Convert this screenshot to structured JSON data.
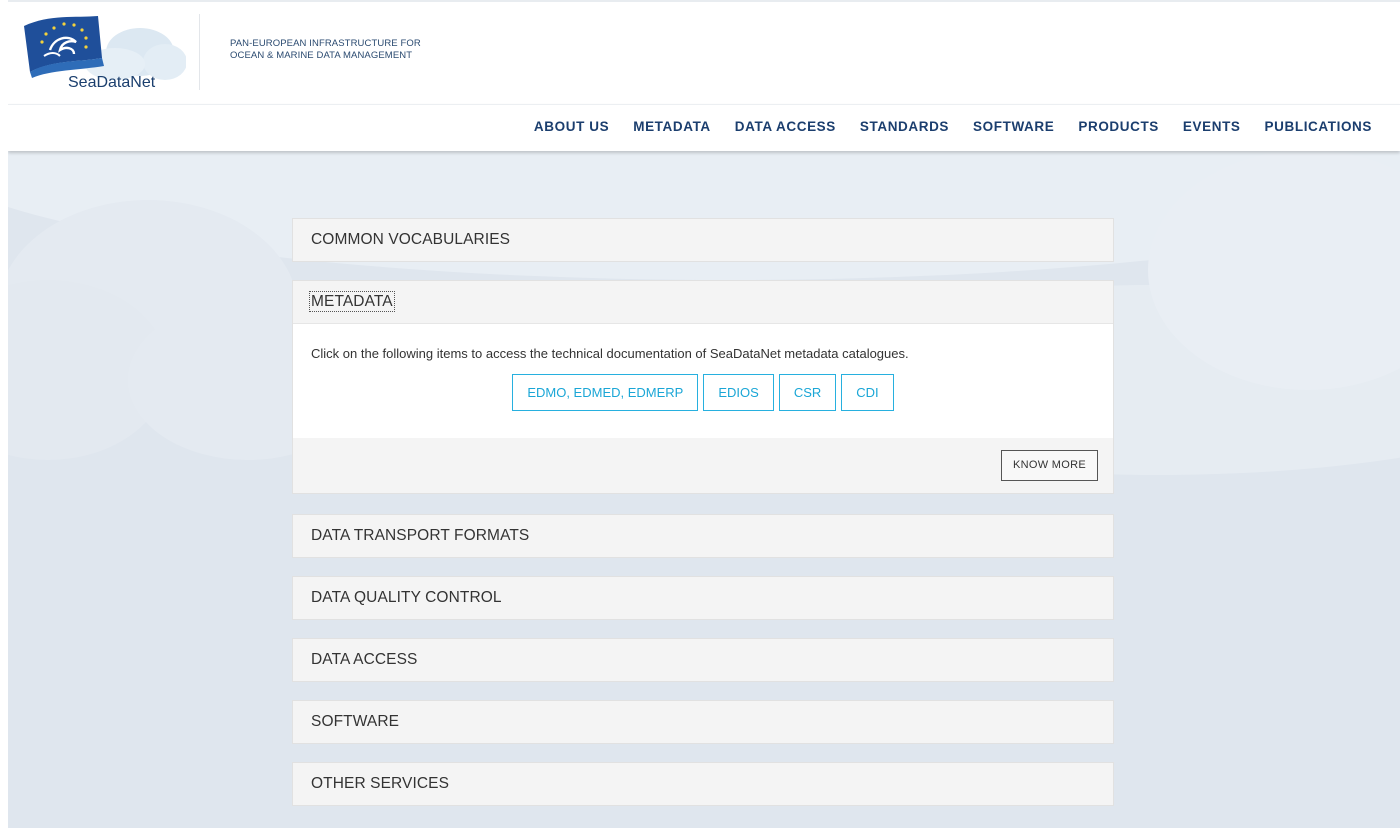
{
  "brand": {
    "logo_text": "SeaDataNet",
    "tagline_line1": "PAN-EUROPEAN INFRASTRUCTURE FOR",
    "tagline_line2": "OCEAN & MARINE DATA MANAGEMENT"
  },
  "nav": {
    "items": [
      {
        "label": "ABOUT US"
      },
      {
        "label": "METADATA"
      },
      {
        "label": "DATA ACCESS"
      },
      {
        "label": "STANDARDS"
      },
      {
        "label": "SOFTWARE"
      },
      {
        "label": "PRODUCTS"
      },
      {
        "label": "EVENTS"
      },
      {
        "label": "PUBLICATIONS"
      }
    ]
  },
  "accordion": {
    "common_vocabularies": "COMMON VOCABULARIES",
    "metadata": {
      "title": "METADATA",
      "description": "Click on the following items to access the technical documentation of SeaDataNet metadata catalogues.",
      "buttons": [
        "EDMO, EDMED, EDMERP",
        "EDIOS",
        "CSR",
        "CDI"
      ],
      "know_more": "KNOW MORE"
    },
    "data_transport_formats": "DATA TRANSPORT FORMATS",
    "data_quality_control": "DATA QUALITY CONTROL",
    "data_access": "DATA ACCESS",
    "software": "SOFTWARE",
    "other_services": "OTHER SERVICES"
  },
  "colors": {
    "navy": "#1b3e6e",
    "accent_blue": "#1aa6d6",
    "panel_bg": "#f4f4f4",
    "page_bg": "#dfe6ee"
  },
  "icons": {
    "logo": "eu-flag-wave-logo-icon"
  }
}
